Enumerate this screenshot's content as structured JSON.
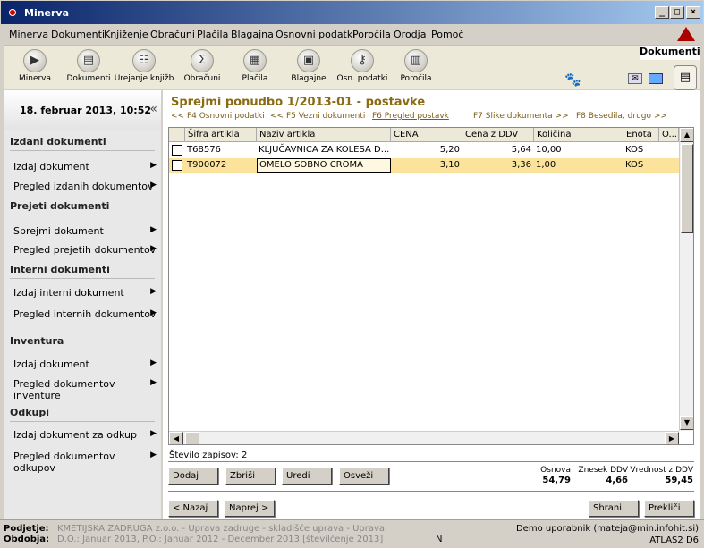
{
  "window": {
    "title": "Minerva"
  },
  "menu": [
    "Minerva",
    "Dokumenti",
    "Knjiženje",
    "Obračuni",
    "Plačila",
    "Blagajna",
    "Osnovni podatki",
    "Poročila",
    "Orodja",
    "Pomoč"
  ],
  "toolbar": {
    "items": [
      {
        "label": "Minerva",
        "icon": "play-icon"
      },
      {
        "label": "Dokumenti",
        "icon": "document-icon"
      },
      {
        "label": "Urejanje knjižb",
        "icon": "books-icon"
      },
      {
        "label": "Obračuni",
        "icon": "calculator-icon"
      },
      {
        "label": "Plačila",
        "icon": "payment-icon"
      },
      {
        "label": "Blagajne",
        "icon": "cashbox-icon"
      },
      {
        "label": "Osn. podatki",
        "icon": "key-icon"
      },
      {
        "label": "Poročila",
        "icon": "chart-icon"
      }
    ],
    "active_tab": "Dokumenti"
  },
  "sidebar": {
    "datetime": "18. februar 2013, 10:52",
    "collapse": "«",
    "sections": [
      {
        "title": "Izdani dokumenti",
        "items": [
          "Izdaj dokument",
          "Pregled izdanih dokumentov"
        ]
      },
      {
        "title": "Prejeti dokumenti",
        "items": [
          "Sprejmi dokument",
          "Pregled prejetih dokumentov"
        ]
      },
      {
        "title": "Interni dokumenti",
        "items": [
          "Izdaj interni dokument",
          "Pregled internih dokumentov"
        ]
      },
      {
        "title": "Inventura",
        "items": [
          "Izdaj dokument",
          "Pregled dokumentov inventure"
        ]
      },
      {
        "title": "Odkupi",
        "items": [
          "Izdaj dokument za odkup",
          "Pregled dokumentov odkupov"
        ]
      }
    ]
  },
  "main": {
    "title": "Sprejmi ponudbo 1/2013-01 - postavke",
    "fkeys": [
      "<< F4 Osnovni podatki",
      "<< F5 Vezni dokumenti",
      "F6 Pregled postavk",
      "F7 Slike dokumenta >>",
      "F8 Besedila, drugo >>"
    ],
    "columns": [
      "Šifra artikla",
      "Naziv artikla",
      "CENA",
      "Cena z DDV",
      "Količina",
      "Enota",
      "O..."
    ],
    "rows": [
      {
        "sifra": "T68576",
        "naziv": "KLJUČAVNICA ZA KOLESA D...",
        "cena": "5,20",
        "cena_ddv": "5,64",
        "kolicina": "10,00",
        "enota": "KOS"
      },
      {
        "sifra": "T900072",
        "naziv": "OMELO SOBNO CROMA",
        "cena": "3,10",
        "cena_ddv": "3,36",
        "kolicina": "1,00",
        "enota": "KOS"
      }
    ],
    "record_count": "Število zapisov: 2",
    "buttons": {
      "add": "Dodaj",
      "delete": "Zbriši",
      "edit": "Uredi",
      "refresh": "Osveži",
      "back": "< Nazaj",
      "forward": "Naprej >",
      "save": "Shrani",
      "cancel": "Prekliči"
    },
    "totals": {
      "osnova_label": "Osnova",
      "osnova": "54,79",
      "ddv_label": "Znesek DDV",
      "ddv": "4,66",
      "vrednost_label": "Vrednost z DDV",
      "vrednost": "59,45"
    }
  },
  "status": {
    "podjetje_label": "Podjetje:",
    "podjetje": "KMETIJSKA ZADRUGA z.o.o. - Uprava zadruge - skladišče uprava - Uprava",
    "obdobja_label": "Obdobja:",
    "obdobja": "D.O.: Januar 2013, P.O.: Januar 2012 - December 2013 [številčenje 2013]",
    "mode": "N",
    "user": "Demo uporabnik (mateja@min.infohit.si)",
    "version": "ATLAS2 D6"
  },
  "colors": {
    "selected_row": "#fbe39b",
    "title": "#8b6a14",
    "titlebar": "#0a246a"
  }
}
